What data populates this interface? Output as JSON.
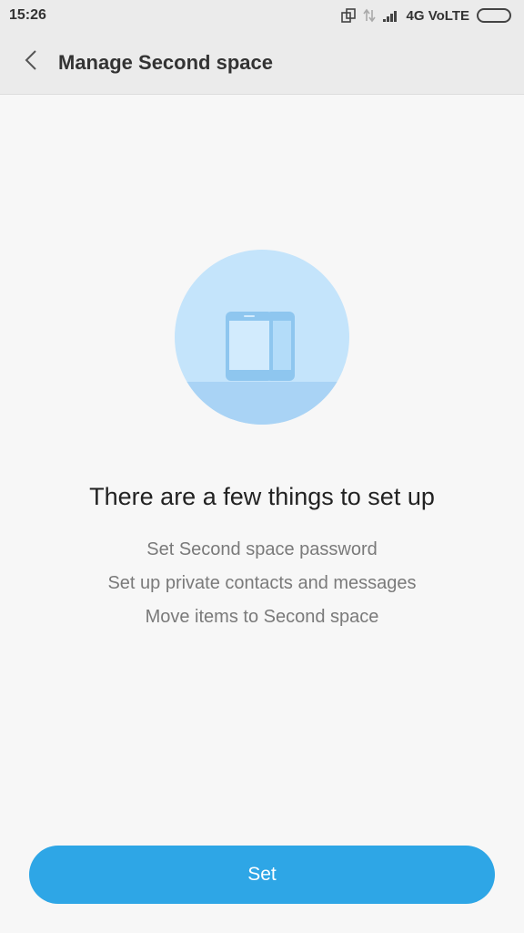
{
  "status_bar": {
    "time": "15:26",
    "network": "4G VoLTE",
    "icons": [
      "screen-rotate-icon",
      "data-transfer-icon",
      "signal-icon",
      "battery-icon"
    ]
  },
  "header": {
    "back_icon": "chevron-left-icon",
    "title": "Manage Second space"
  },
  "illustration": {
    "icon": "dual-phone-icon",
    "circle_color": "#c4e4fb",
    "floor_color": "#a9d3f5",
    "phone_color": "#8ec6ef"
  },
  "main": {
    "heading": "There are a few things to set up",
    "steps": [
      "Set Second space password",
      "Set up private contacts and messages",
      "Move items to Second space"
    ]
  },
  "actions": {
    "set_label": "Set",
    "accent": "#2ea6e6"
  }
}
